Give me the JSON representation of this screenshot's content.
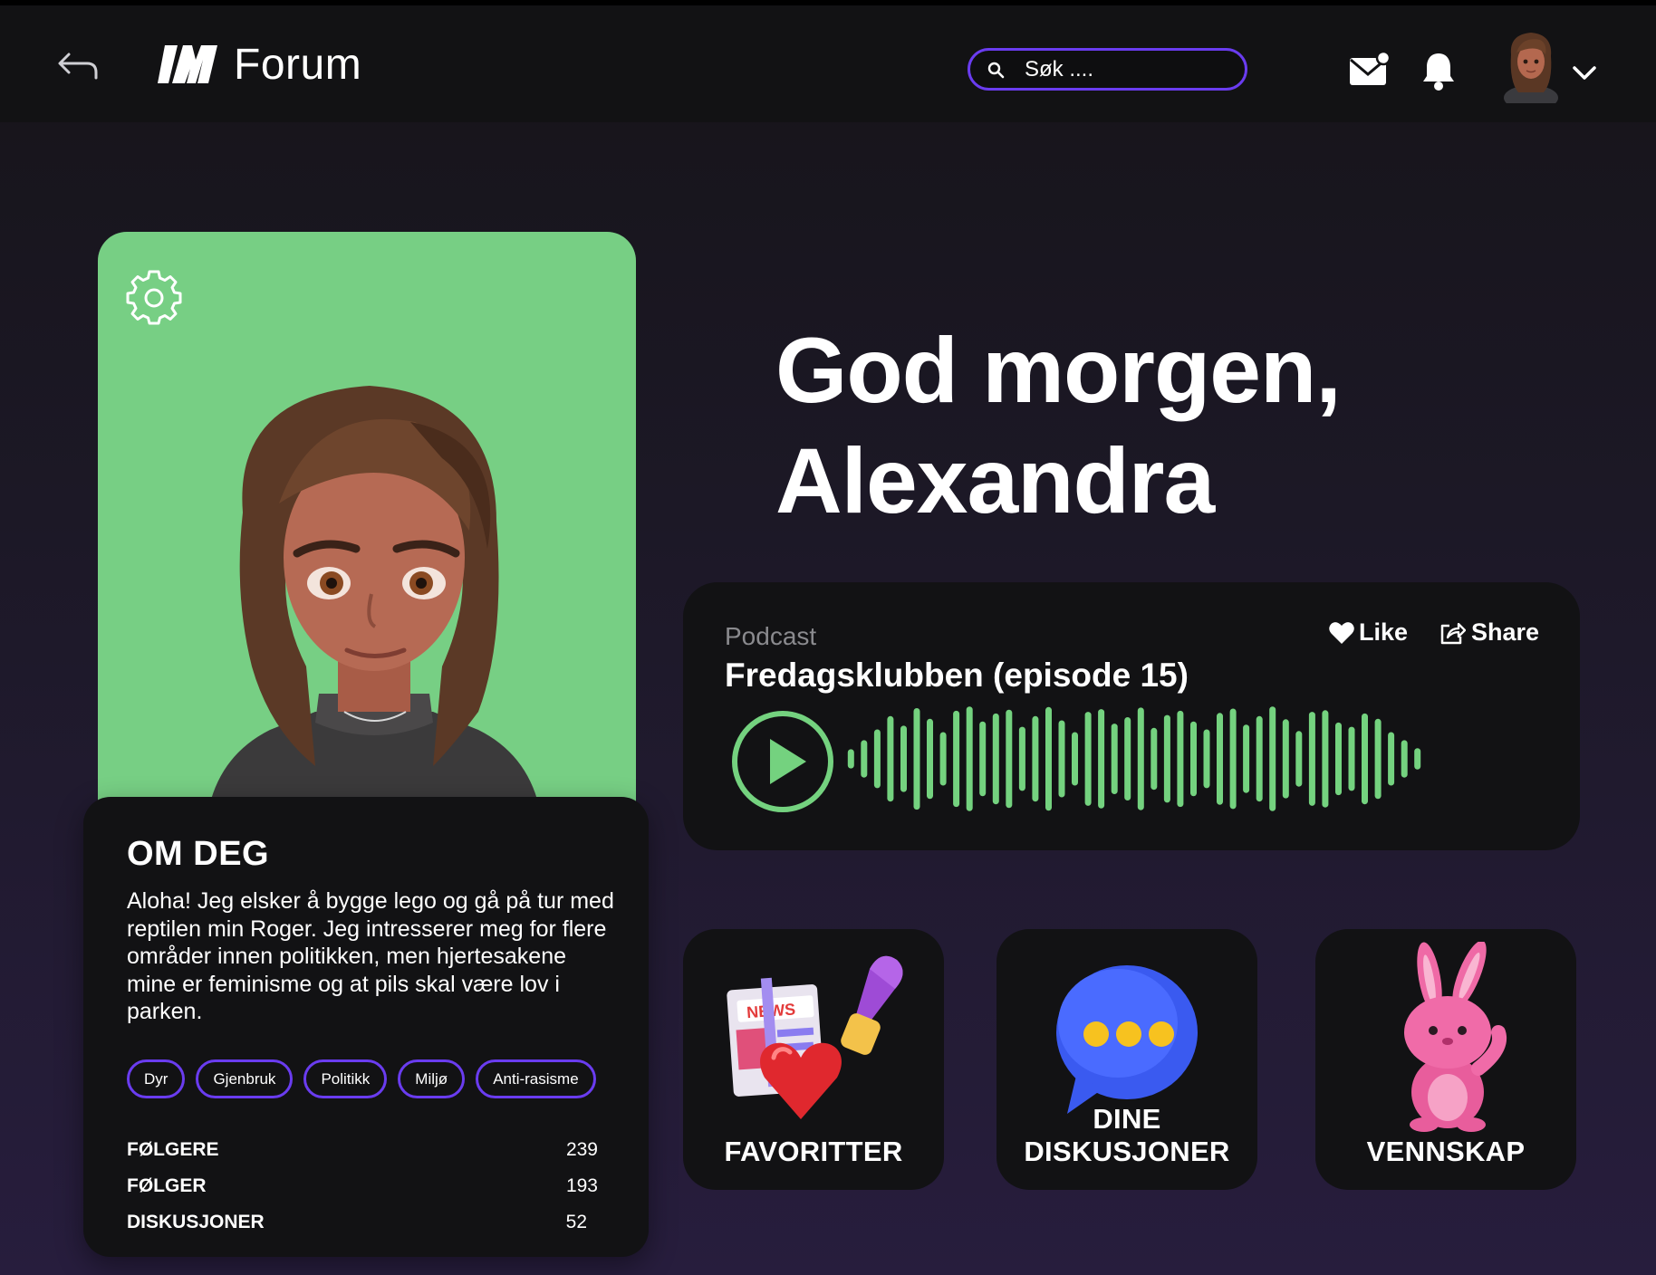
{
  "header": {
    "app_title": "Forum",
    "search_placeholder": "Søk ....",
    "icons": [
      "back-arrow-icon",
      "forum-logo",
      "search-icon",
      "mail-icon",
      "bell-icon",
      "avatar",
      "chevron-down-icon"
    ]
  },
  "greeting": {
    "line1": "God morgen,",
    "line2": "Alexandra"
  },
  "profile": {
    "about_title": "OM DEG",
    "about_text": "Aloha! Jeg elsker å bygge lego og gå på tur med reptilen min Roger. Jeg intresserer meg for flere områder innen politikken, men hjertesakene mine er feminisme og at pils skal være lov i parken.",
    "tags": [
      "Dyr",
      "Gjenbruk",
      "Politikk",
      "Miljø",
      "Anti-rasisme"
    ],
    "stats": [
      {
        "label": "FØLGERE",
        "value": "239"
      },
      {
        "label": "FØLGER",
        "value": "193"
      },
      {
        "label": "DISKUSJONER",
        "value": "52"
      }
    ],
    "photo_bg": "#77cf84"
  },
  "podcast": {
    "label": "Podcast",
    "title": "Fredagsklubben (episode 15)",
    "like_label": "Like",
    "share_label": "Share",
    "accent": "#74d27f"
  },
  "tiles": [
    {
      "label": "FAVORITTER",
      "badge": "NEWS"
    },
    {
      "label": "DINE DISKUSJONER"
    },
    {
      "label": "VENNSKAP"
    }
  ],
  "colors": {
    "accent_purple": "#6a3cf0",
    "accent_green": "#74d27f",
    "card_bg": "#121214"
  }
}
